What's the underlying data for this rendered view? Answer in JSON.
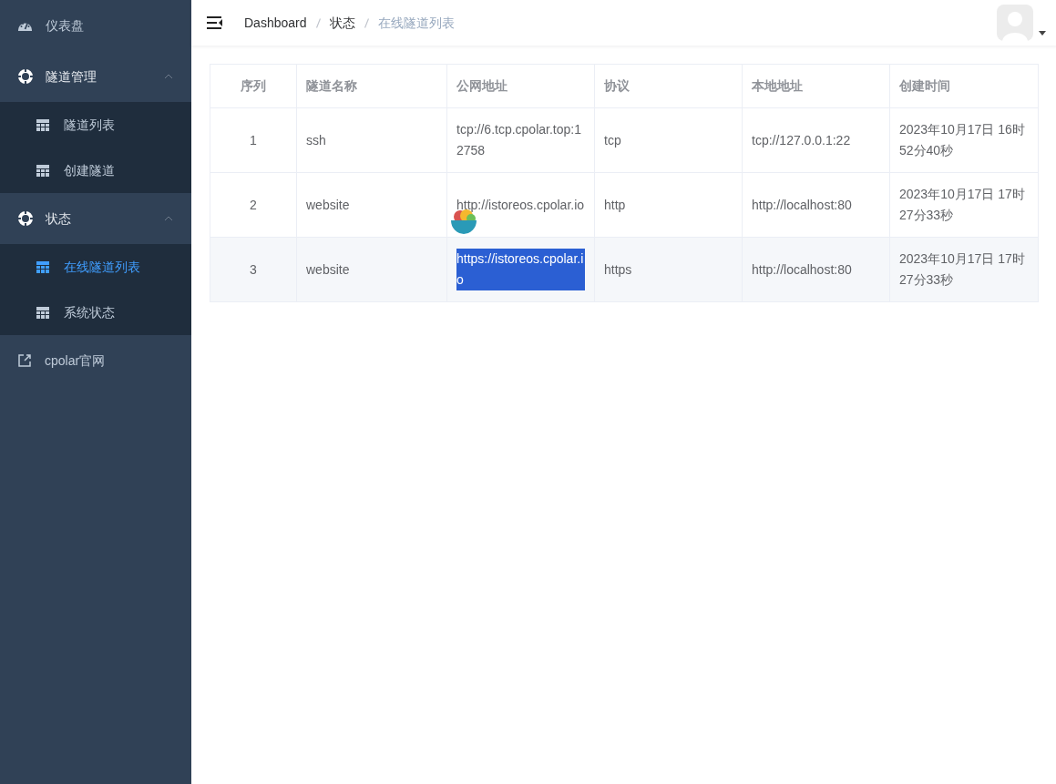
{
  "sidebar": {
    "items": [
      {
        "kind": "dashboard",
        "label": "仪表盘",
        "selected": false
      },
      {
        "kind": "group",
        "label": "隧道管理",
        "expanded": true,
        "children": [
          {
            "label": "隧道列表",
            "selected": false
          },
          {
            "label": "创建隧道",
            "selected": false
          }
        ]
      },
      {
        "kind": "group",
        "label": "状态",
        "expanded": true,
        "children": [
          {
            "label": "在线隧道列表",
            "selected": true
          },
          {
            "label": "系统状态",
            "selected": false
          }
        ]
      },
      {
        "kind": "link",
        "label": "cpolar官网",
        "selected": false
      }
    ]
  },
  "breadcrumb": [
    "Dashboard",
    "状态",
    "在线隧道列表"
  ],
  "table": {
    "columns": [
      "序列",
      "隧道名称",
      "公网地址",
      "协议",
      "本地地址",
      "创建时间"
    ],
    "rows": [
      {
        "hovered": false,
        "address_selected": false,
        "cells": [
          "1",
          "ssh",
          "tcp://6.tcp.cpolar.top:12758",
          "tcp",
          "tcp://127.0.0.1:22",
          "2023年10月17日 16时52分40秒"
        ]
      },
      {
        "hovered": false,
        "address_selected": false,
        "cells": [
          "2",
          "website",
          "http://istoreos.cpolar.io",
          "http",
          "http://localhost:80",
          "2023年10月17日 17时27分33秒"
        ]
      },
      {
        "hovered": true,
        "address_selected": true,
        "cells": [
          "3",
          "website",
          "https://istoreos.cpolar.io",
          "https",
          "http://localhost:80",
          "2023年10月17日 17时27分33秒"
        ]
      }
    ]
  }
}
